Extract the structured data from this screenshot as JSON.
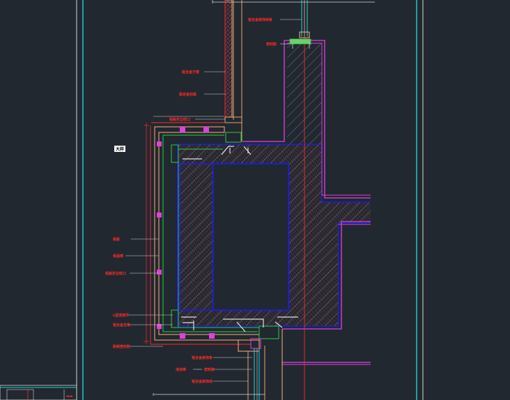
{
  "drawing": {
    "title": "Curtain wall column cladding node detail (CAD section view)",
    "scale_tag": "大样",
    "colors": {
      "background": "#212830",
      "concrete_hatch": "#9aa0a6",
      "concrete_outline": "#1a1aff",
      "magenta": "#e040e0",
      "green": "#2ecc40",
      "salmon": "#ffb07a",
      "red_axis": "#ff2a2a",
      "cyan": "#22d3d3",
      "white": "#e0e0e0"
    }
  },
  "callouts": [
    {
      "id": "top-1",
      "text": "铝合金装饰线条"
    },
    {
      "id": "top-2",
      "text": "密封胶"
    },
    {
      "id": "left-1",
      "text": "铝合金方管"
    },
    {
      "id": "left-2",
      "text": "铝合金扣板"
    },
    {
      "id": "left-3",
      "text": "铝板"
    },
    {
      "id": "left-4",
      "text": "铝板折边收口"
    },
    {
      "id": "mid-1",
      "text": "铝板"
    },
    {
      "id": "mid-2",
      "text": "保温棉"
    },
    {
      "id": "mid-3",
      "text": "铝板折边收口"
    },
    {
      "id": "mid-4",
      "text": "L型连接件"
    },
    {
      "id": "mid-5",
      "text": "铝合金龙骨"
    },
    {
      "id": "mid-6",
      "text": "耐候密封胶"
    },
    {
      "id": "bot-1",
      "text": "铝合金装饰条"
    },
    {
      "id": "bot-2",
      "text": "泡沫棒"
    },
    {
      "id": "bot-3",
      "text": "密封胶"
    },
    {
      "id": "bot-4",
      "text": "铝合金装饰线"
    }
  ]
}
